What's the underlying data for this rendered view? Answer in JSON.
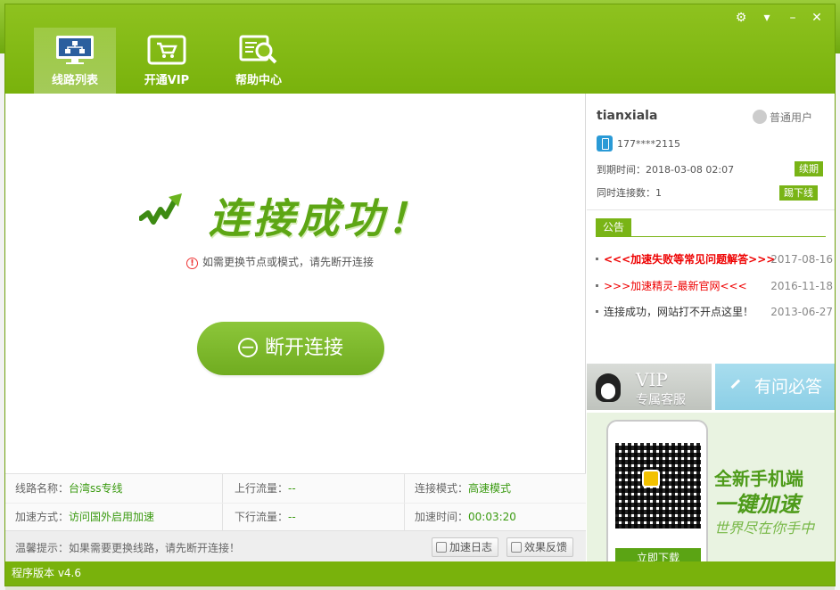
{
  "tabs": [
    {
      "label": "线路列表"
    },
    {
      "label": "开通VIP"
    },
    {
      "label": "帮助中心"
    }
  ],
  "main": {
    "status_title": "连接成功！",
    "warning": "如需更换节点或模式，请先断开连接",
    "disconnect_label": "断开连接"
  },
  "info": {
    "line_name_label": "线路名称：",
    "line_name_value": "台湾ss专线",
    "upload_label": "上行流量：",
    "upload_value": "--",
    "mode_label": "连接模式：",
    "mode_value": "高速模式",
    "accel_label": "加速方式：",
    "accel_value": "访问国外启用加速",
    "download_label": "下行流量：",
    "download_value": "--",
    "time_label": "加速时间：",
    "time_value": "00:03:20"
  },
  "tip": {
    "text": "温馨提示：如果需要更换线路，请先断开连接！",
    "log_label": "加速日志",
    "feedback_label": "效果反馈"
  },
  "user": {
    "name": "tianxiala",
    "type": "普通用户",
    "phone": "177****2115",
    "expire_label": "到期时间：",
    "expire_value": "2018-03-08 02:07",
    "renew_label": "续期",
    "conn_label": "同时连接数：",
    "conn_value": "1",
    "kick_label": "踢下线"
  },
  "notice": {
    "tag": "公告",
    "items": [
      {
        "title": "<<<加速失败等常见问题解答>>>",
        "date": "2017-08-16"
      },
      {
        "title": ">>>加速精灵-最新官网<<<",
        "date": "2016-11-18"
      },
      {
        "title": "连接成功，网站打不开点这里！",
        "date": "2013-06-27"
      }
    ]
  },
  "service": {
    "vip_title": "VIP",
    "vip_subtitle": "专属客服",
    "ask_label": "有问必答"
  },
  "promo": {
    "line1": "全新手机端",
    "line2": "一键加速",
    "line3": "世界尽在你手中",
    "download_label": "立即下载"
  },
  "footer": {
    "version": "程序版本 v4.6"
  },
  "colors": {
    "brand_green": "#79b20c",
    "accent_green": "#5da614",
    "alert_red": "#e00000"
  }
}
